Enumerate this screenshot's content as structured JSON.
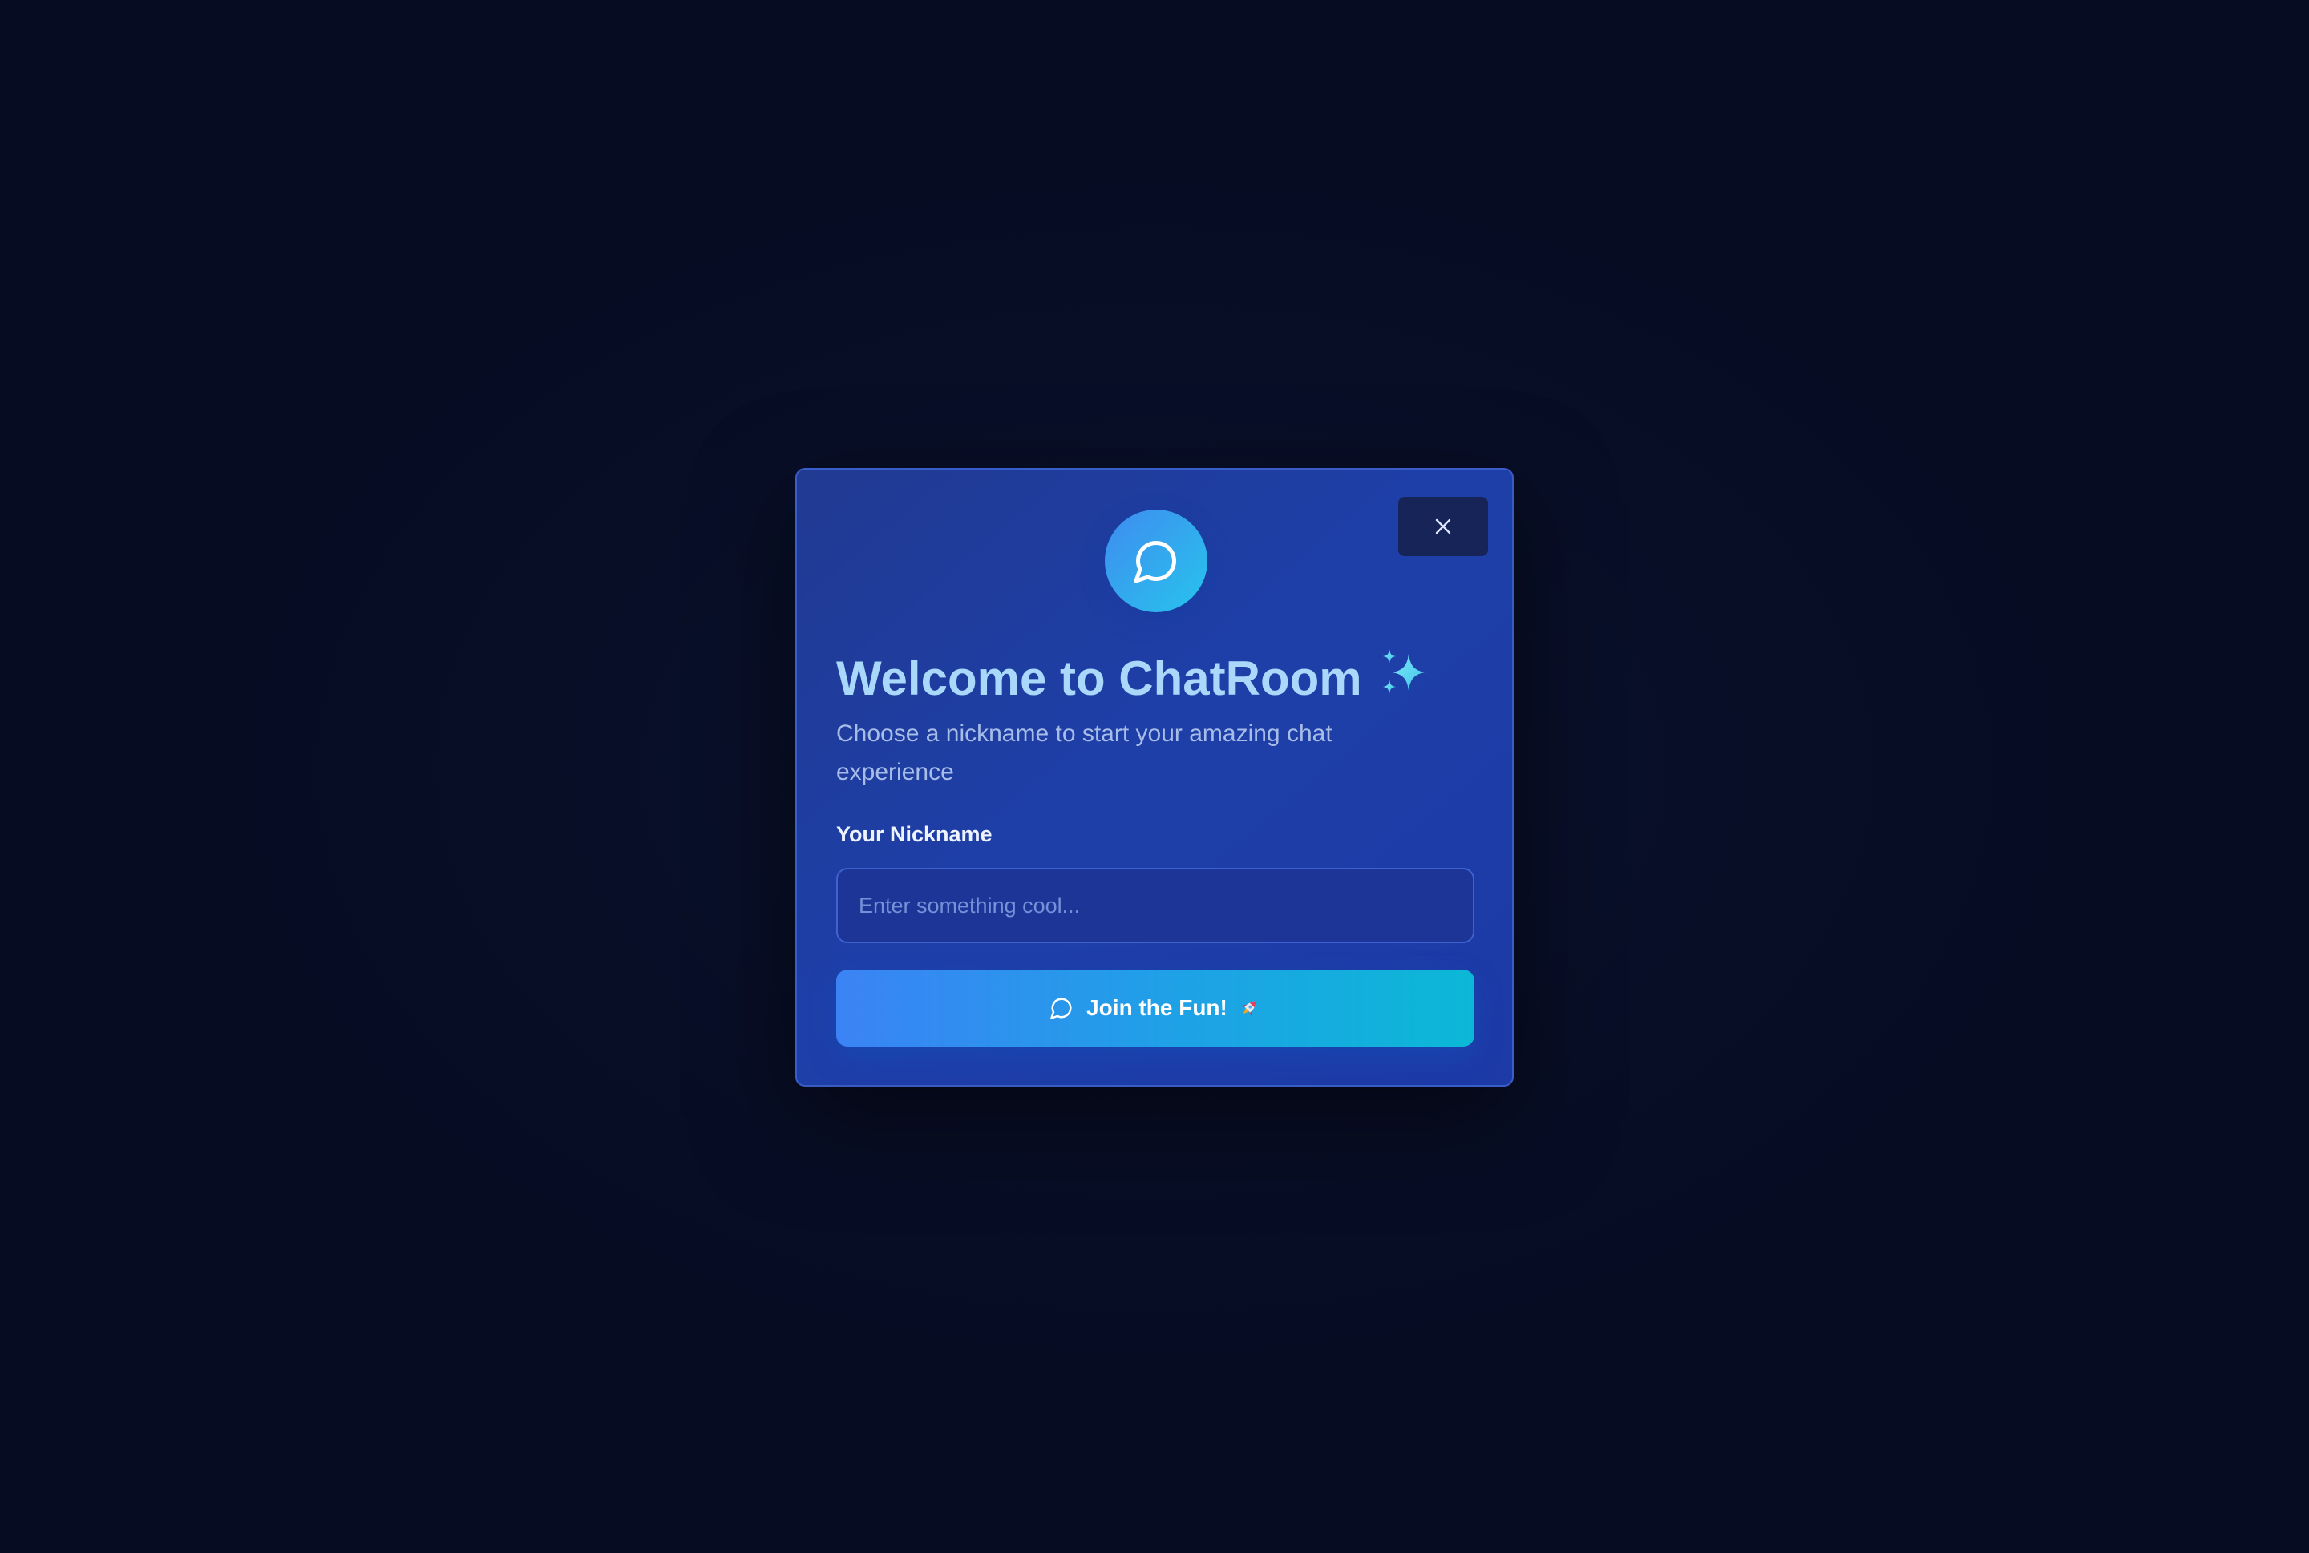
{
  "modal": {
    "title": "Welcome to ChatRoom",
    "title_icon": "sparkles-icon",
    "subtitle": "Choose a nickname to start your amazing chat experience",
    "logo_icon": "chat-bubble-icon",
    "close_icon": "close-icon",
    "nickname_label": "Your Nickname",
    "nickname_placeholder": "Enter something cool...",
    "nickname_value": "",
    "join_button": {
      "label": "Join the Fun!",
      "icon": "chat-bubble-icon",
      "trailing_icon": "rocket-icon"
    }
  },
  "colors": {
    "page_background": "#060c22",
    "modal_background": "#1e3fa8",
    "title": "#a9d8fb",
    "subtitle": "#a7bde8",
    "button_gradient_start": "#3b83f5",
    "button_gradient_end": "#0bb8d6",
    "logo_gradient_start": "#3f8cf0",
    "logo_gradient_end": "#27c4ec"
  }
}
